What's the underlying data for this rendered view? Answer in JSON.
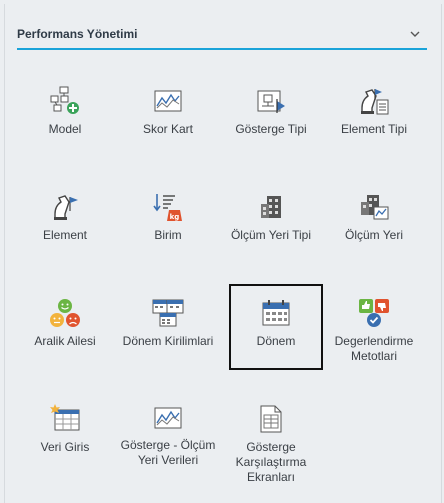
{
  "section": {
    "title": "Performans Yönetimi"
  },
  "tiles": [
    {
      "label": "Model",
      "icon": "model-hierarchy-icon"
    },
    {
      "label": "Skor Kart",
      "icon": "scorecard-chart-icon"
    },
    {
      "label": "Gösterge Tipi",
      "icon": "indicator-type-icon"
    },
    {
      "label": "Element Tipi",
      "icon": "element-type-icon"
    },
    {
      "label": "Element",
      "icon": "element-icon"
    },
    {
      "label": "Birim",
      "icon": "unit-kg-icon"
    },
    {
      "label": "Ölçüm Yeri Tipi",
      "icon": "building-type-icon"
    },
    {
      "label": "Ölçüm Yeri",
      "icon": "building-chart-icon"
    },
    {
      "label": "Aralik Ailesi",
      "icon": "smiley-faces-icon"
    },
    {
      "label": "Dönem Kirilimlari",
      "icon": "calendars-icon"
    },
    {
      "label": "Dönem",
      "icon": "calendar-icon",
      "selected": true
    },
    {
      "label": "Degerlendirme Metotlari",
      "icon": "thumbs-evaluation-icon"
    },
    {
      "label": "Veri Giris",
      "icon": "data-entry-icon"
    },
    {
      "label": "Gösterge - Ölçüm Yeri Verileri",
      "icon": "chart-data-icon"
    },
    {
      "label": "Gösterge Karşılaştırma Ekranları",
      "icon": "comparison-document-icon"
    }
  ]
}
